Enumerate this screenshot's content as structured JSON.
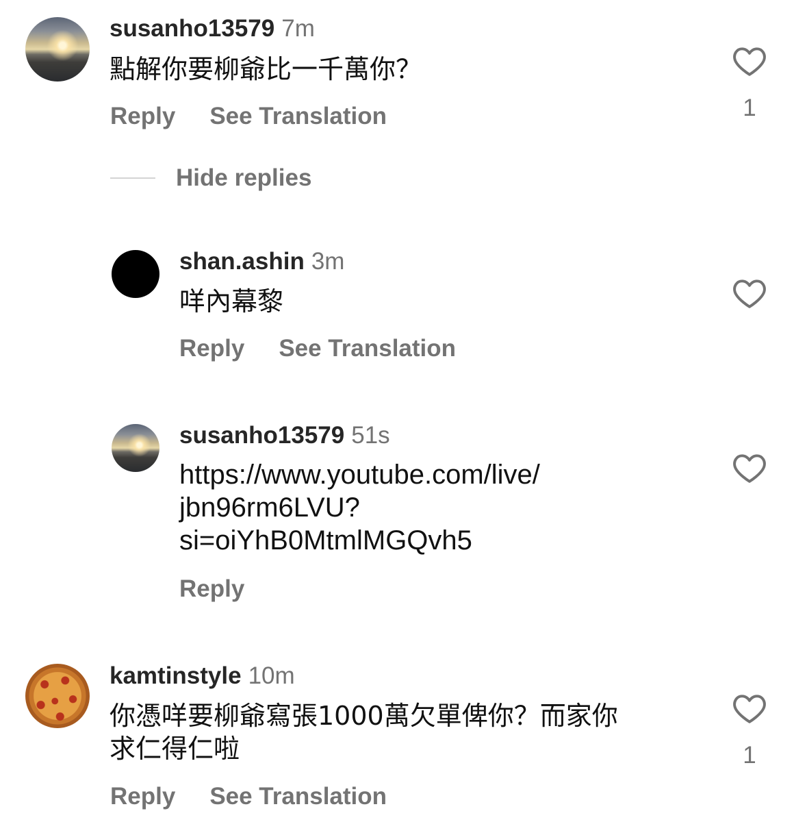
{
  "comments": [
    {
      "username": "susanho13579",
      "time": "7m",
      "text": "點解你要柳爺比一千萬你？",
      "reply_label": "Reply",
      "translate_label": "See Translation",
      "likes": "1",
      "avatar_icon": "sunset-photo"
    },
    {
      "username": "kamtinstyle",
      "time": "10m",
      "text_lines": [
        "你憑咩要柳爺寫張1000萬欠單俾你？而家你",
        "求仁得仁啦"
      ],
      "reply_label": "Reply",
      "translate_label": "See Translation",
      "likes": "1",
      "avatar_icon": "pizza-photo"
    }
  ],
  "thread": {
    "hide_replies_label": "Hide replies",
    "replies": [
      {
        "username": "shan.ashin",
        "time": "3m",
        "text": "咩內幕黎",
        "reply_label": "Reply",
        "translate_label": "See Translation",
        "avatar_icon": "black-circle"
      },
      {
        "username": "susanho13579",
        "time": "51s",
        "text_lines": [
          "https://www.youtube.com/live/",
          "jbn96rm6LVU?",
          "si=oiYhB0MtmlMGQvh5"
        ],
        "reply_label": "Reply",
        "avatar_icon": "sunset-photo"
      }
    ]
  },
  "icons": {
    "like": "heart-outline-icon"
  }
}
